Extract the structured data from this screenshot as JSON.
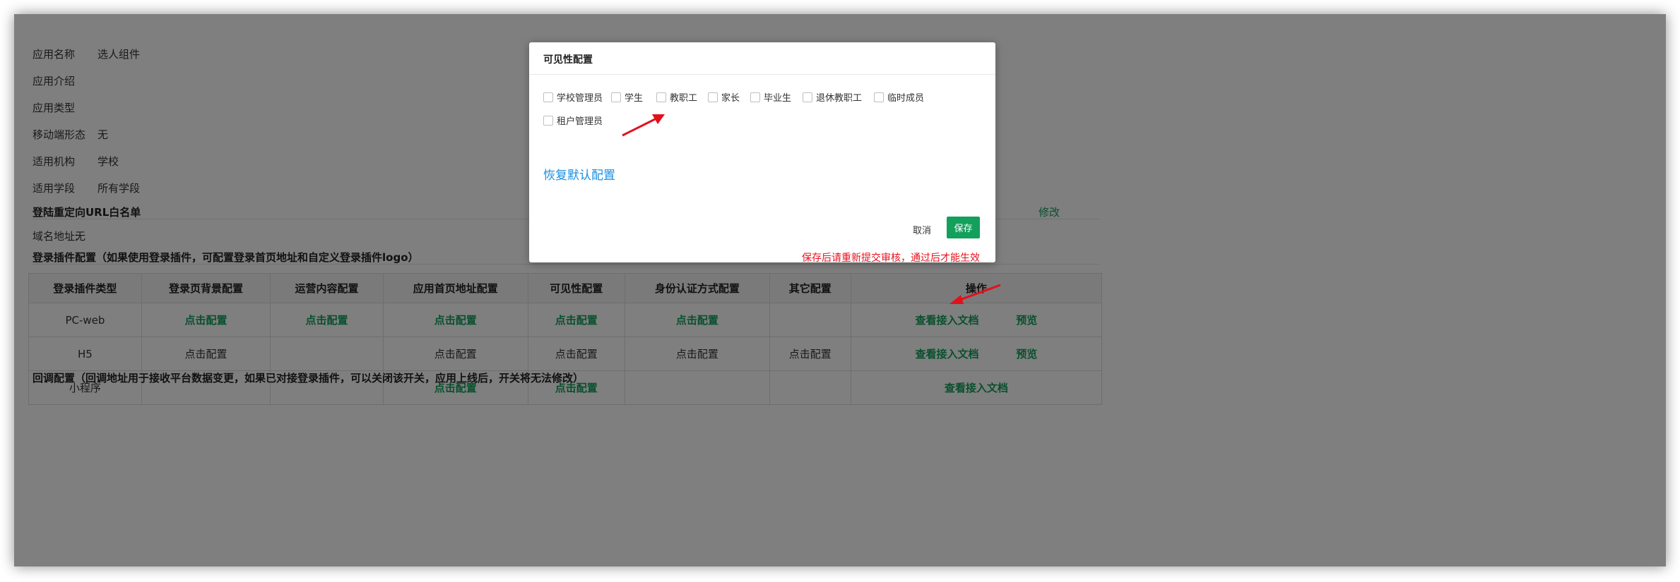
{
  "app_info": {
    "name_label": "应用名称",
    "name_value": "选人组件",
    "intro_label": "应用介绍",
    "type_label": "应用类型",
    "mobile_label": "移动端形态",
    "mobile_value": "无",
    "org_label": "适用机构",
    "org_value": "学校",
    "stage_label": "适用学段",
    "stage_value": "所有学段"
  },
  "whitelist": {
    "title": "登陆重定向URL白名单",
    "edit_label": "修改",
    "domain_label": "域名地址:",
    "domain_value": "无"
  },
  "plugin_section": {
    "title": "登录插件配置（如果使用登录插件，可配置登录首页地址和自定义登录插件logo）",
    "headers": [
      "登录插件类型",
      "登录页背景配置",
      "运营内容配置",
      "应用首页地址配置",
      "可见性配置",
      "身份认证方式配置",
      "其它配置",
      "操作"
    ],
    "rows": [
      {
        "type": "PC-web",
        "bg": "点击配置",
        "ops": "点击配置",
        "home": "点击配置",
        "vis": "点击配置",
        "auth": "点击配置",
        "other": "",
        "doc": "查看接入文档",
        "preview": "预览"
      },
      {
        "type": "H5",
        "bg": "点击配置",
        "ops": "",
        "home": "点击配置",
        "vis": "点击配置",
        "auth": "点击配置",
        "other": "点击配置",
        "doc": "查看接入文档",
        "preview": "预览"
      },
      {
        "type": "小程序",
        "bg": "",
        "ops": "",
        "home": "点击配置",
        "vis": "点击配置",
        "auth": "",
        "other": "",
        "doc": "查看接入文档",
        "preview": ""
      }
    ]
  },
  "callback_title": "回调配置（回调地址用于接收平台数据变更，如果已对接登录插件，可以关闭该开关，应用上线后，开关将无法修改）",
  "modal": {
    "title": "可见性配置",
    "options": [
      "学校管理员",
      "学生",
      "教职工",
      "家长",
      "毕业生",
      "退休教职工",
      "临时成员",
      "租户管理员"
    ],
    "restore_label": "恢复默认配置",
    "cancel_label": "取消",
    "save_label": "保存",
    "warning": "保存后请重新提交审核，通过后才能生效"
  },
  "colors": {
    "accent": "#12a05c",
    "link": "#1b8fe0",
    "warning": "#e8101c",
    "arrow": "#e3101c"
  }
}
